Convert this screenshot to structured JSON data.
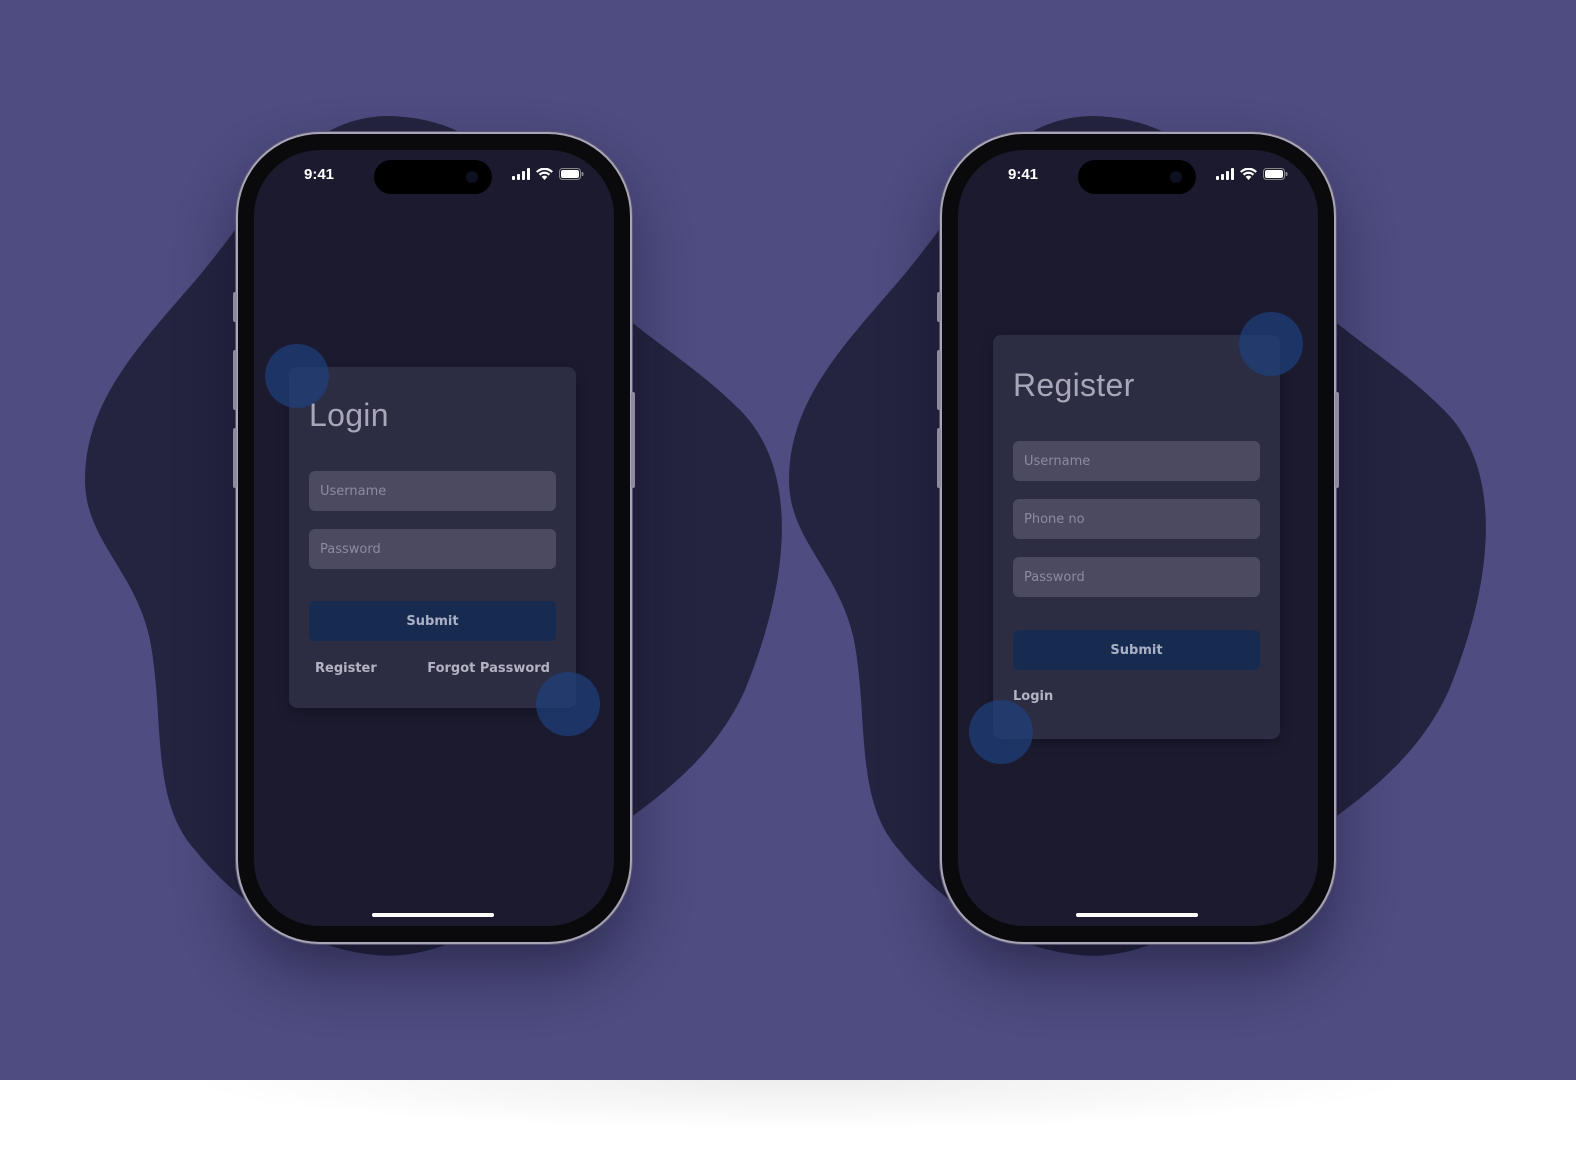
{
  "colors": {
    "backdrop": "#4e4c80",
    "blob": "#252440",
    "screen": "#1b1a2f",
    "card": "#3a3a52",
    "field": "#4b4a60",
    "submit_button": "#172a50",
    "glow": "#1f3f7a"
  },
  "status_bar": {
    "time": "9:41"
  },
  "login_screen": {
    "title": "Login",
    "username_placeholder": "Username",
    "password_placeholder": "Password",
    "submit_label": "Submit",
    "register_link": "Register",
    "forgot_password_link": "Forgot Password"
  },
  "register_screen": {
    "title": "Register",
    "username_placeholder": "Username",
    "phone_placeholder": "Phone no",
    "password_placeholder": "Password",
    "submit_label": "Submit",
    "login_link": "Login"
  },
  "icons": [
    "cellular-signal-icon",
    "wifi-icon",
    "battery-icon"
  ]
}
